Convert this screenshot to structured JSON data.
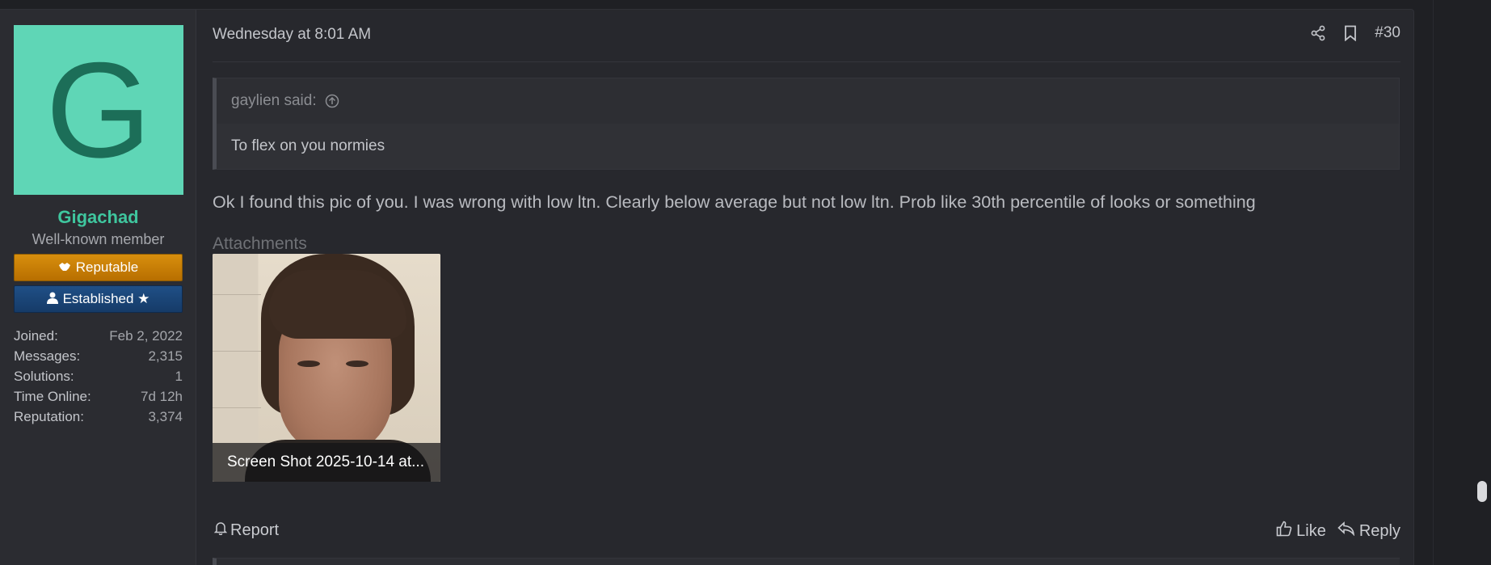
{
  "author": {
    "avatar_letter": "G",
    "avatar_color": "#5fd6b6",
    "name": "Gigachad",
    "name_color": "#3fc69e",
    "title": "Well-known member",
    "banners": [
      {
        "label": "Reputable",
        "icon": "handshake-icon",
        "color": "#d88f0d"
      },
      {
        "label": "Established ★",
        "icon": "user-icon",
        "color": "#1f4f86"
      }
    ],
    "stats": [
      {
        "label": "Joined:",
        "value": "Feb 2, 2022"
      },
      {
        "label": "Messages:",
        "value": "2,315"
      },
      {
        "label": "Solutions:",
        "value": "1"
      },
      {
        "label": "Time Online:",
        "value": "7d 12h"
      },
      {
        "label": "Reputation:",
        "value": "3,374"
      }
    ]
  },
  "post": {
    "timestamp": "Wednesday at 8:01 AM",
    "post_number": "#30",
    "quote": {
      "author_line": "gaylien said:",
      "text": "To flex on you normies"
    },
    "message": "Ok I found this pic of you. I was wrong with low ltn. Clearly below average but not low ltn. Prob like 30th percentile of looks or something",
    "attachments_title": "Attachments",
    "attachment_caption": "Screen Shot 2025-10-14 at..."
  },
  "footer": {
    "report_label": "Report",
    "like_label": "Like",
    "reply_label": "Reply"
  }
}
